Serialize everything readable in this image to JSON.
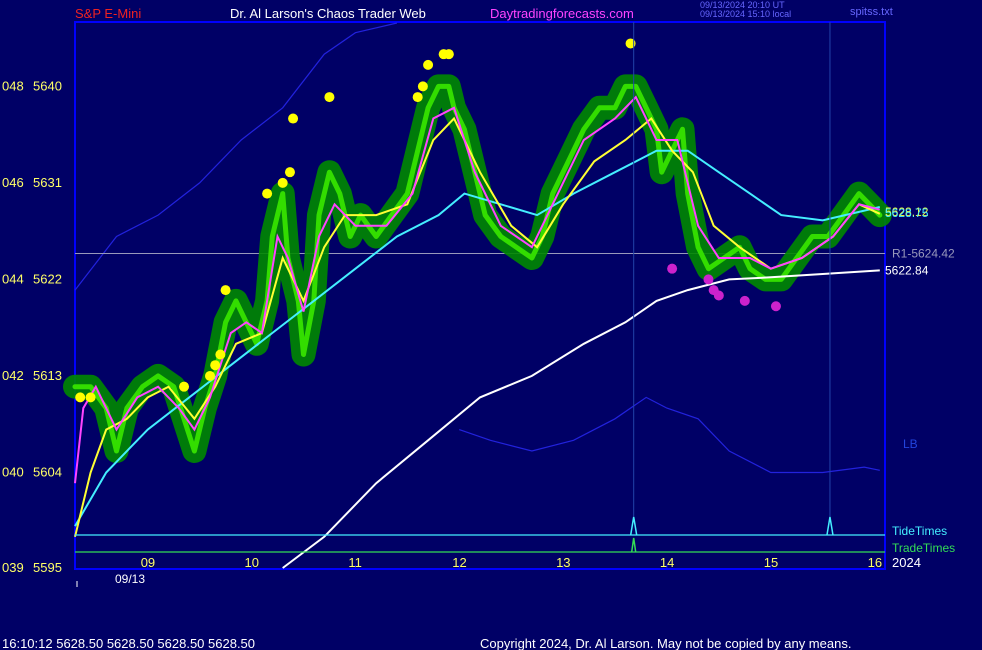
{
  "header": {
    "symbol": "S&P E-Mini",
    "site_title": "Dr. Al Larson's Chaos Trader Web",
    "url": "Daytradingforecasts.com",
    "timestamp_ut": "09/13/2024 20:10 UT",
    "timestamp_local": "09/13/2024 15:10 local",
    "file": "spitss.txt"
  },
  "footer": {
    "quote": "16:10:12  5628.50 5628.50 5628.50 5628.50",
    "copyright": "Copyright 2024, Dr. Al Larson. May not be copied by any means."
  },
  "colors": {
    "background": "#000066",
    "frame": "#0000ff",
    "price": "#33dd00",
    "price_glow": "#008800",
    "fast_avg": "#ff44ff",
    "mid_avg": "#ffff33",
    "slow_avg": "#44eeff",
    "long_avg": "#ffffff",
    "upper_band": "#2222dd",
    "tide": "#44eeff",
    "trade": "#33dd55",
    "yellow_dot": "#ffff00",
    "magenta_dot": "#cc22cc"
  },
  "chart_data": {
    "type": "line",
    "ylim": [
      5595,
      5646
    ],
    "y_ticks": [
      {
        "left": "039",
        "price": 5595,
        "label": "5595"
      },
      {
        "left": "040",
        "price": 5604,
        "label": "5604"
      },
      {
        "left": "042",
        "price": 5613,
        "label": "5613"
      },
      {
        "left": "044",
        "price": 5622,
        "label": "5622"
      },
      {
        "left": "046",
        "price": 5631,
        "label": "5631"
      },
      {
        "left": "048",
        "price": 5640,
        "label": "5640"
      }
    ],
    "x_ticks": [
      "09",
      "10",
      "11",
      "12",
      "13",
      "14",
      "15",
      "16"
    ],
    "x_tick_hours": [
      9,
      10,
      11,
      12,
      13,
      14,
      15,
      16
    ],
    "date_label": "09/13",
    "year_label": "2024",
    "xlim": [
      8.3,
      16.1
    ],
    "price_series": [
      [
        8.3,
        5612
      ],
      [
        8.45,
        5612
      ],
      [
        8.6,
        5610
      ],
      [
        8.7,
        5606
      ],
      [
        8.8,
        5610
      ],
      [
        8.95,
        5612
      ],
      [
        9.1,
        5613
      ],
      [
        9.25,
        5612
      ],
      [
        9.35,
        5609
      ],
      [
        9.45,
        5606
      ],
      [
        9.55,
        5610
      ],
      [
        9.65,
        5613
      ],
      [
        9.75,
        5618
      ],
      [
        9.85,
        5620
      ],
      [
        9.95,
        5618
      ],
      [
        10.05,
        5616
      ],
      [
        10.15,
        5620
      ],
      [
        10.2,
        5626
      ],
      [
        10.3,
        5630
      ],
      [
        10.35,
        5624
      ],
      [
        10.45,
        5620
      ],
      [
        10.5,
        5615
      ],
      [
        10.6,
        5620
      ],
      [
        10.65,
        5628
      ],
      [
        10.75,
        5632
      ],
      [
        10.85,
        5630
      ],
      [
        10.95,
        5626
      ],
      [
        11.05,
        5628
      ],
      [
        11.2,
        5626
      ],
      [
        11.35,
        5628
      ],
      [
        11.5,
        5630
      ],
      [
        11.6,
        5634
      ],
      [
        11.7,
        5638
      ],
      [
        11.8,
        5640
      ],
      [
        11.9,
        5640
      ],
      [
        11.95,
        5638
      ],
      [
        12.05,
        5636
      ],
      [
        12.15,
        5632
      ],
      [
        12.25,
        5628
      ],
      [
        12.4,
        5626
      ],
      [
        12.55,
        5625
      ],
      [
        12.7,
        5624
      ],
      [
        12.8,
        5626
      ],
      [
        12.9,
        5630
      ],
      [
        13.0,
        5632
      ],
      [
        13.1,
        5634
      ],
      [
        13.2,
        5636
      ],
      [
        13.35,
        5638
      ],
      [
        13.5,
        5638
      ],
      [
        13.6,
        5640
      ],
      [
        13.7,
        5640
      ],
      [
        13.8,
        5638
      ],
      [
        13.9,
        5636
      ],
      [
        13.95,
        5632
      ],
      [
        14.05,
        5634
      ],
      [
        14.15,
        5636
      ],
      [
        14.2,
        5630
      ],
      [
        14.3,
        5625
      ],
      [
        14.4,
        5623
      ],
      [
        14.55,
        5624
      ],
      [
        14.7,
        5625
      ],
      [
        14.8,
        5623
      ],
      [
        14.95,
        5622
      ],
      [
        15.1,
        5622
      ],
      [
        15.25,
        5624
      ],
      [
        15.4,
        5626
      ],
      [
        15.55,
        5626
      ],
      [
        15.7,
        5628
      ],
      [
        15.85,
        5630
      ],
      [
        15.95,
        5629
      ],
      [
        16.05,
        5628
      ]
    ],
    "fast_avg": [
      [
        8.3,
        5603
      ],
      [
        8.38,
        5610
      ],
      [
        8.5,
        5612
      ],
      [
        8.7,
        5608
      ],
      [
        8.9,
        5611
      ],
      [
        9.1,
        5612
      ],
      [
        9.3,
        5610
      ],
      [
        9.45,
        5608
      ],
      [
        9.6,
        5611
      ],
      [
        9.8,
        5617
      ],
      [
        9.95,
        5618
      ],
      [
        10.1,
        5617
      ],
      [
        10.25,
        5626
      ],
      [
        10.35,
        5624
      ],
      [
        10.5,
        5619
      ],
      [
        10.65,
        5626
      ],
      [
        10.8,
        5629
      ],
      [
        11.0,
        5627
      ],
      [
        11.3,
        5627
      ],
      [
        11.55,
        5630
      ],
      [
        11.75,
        5637
      ],
      [
        11.95,
        5638
      ],
      [
        12.15,
        5632
      ],
      [
        12.4,
        5627
      ],
      [
        12.7,
        5625
      ],
      [
        12.95,
        5630
      ],
      [
        13.2,
        5635
      ],
      [
        13.5,
        5637
      ],
      [
        13.7,
        5639
      ],
      [
        13.9,
        5635
      ],
      [
        14.1,
        5635
      ],
      [
        14.3,
        5627
      ],
      [
        14.5,
        5624
      ],
      [
        14.8,
        5624
      ],
      [
        15.0,
        5623
      ],
      [
        15.3,
        5624
      ],
      [
        15.6,
        5626
      ],
      [
        15.85,
        5629
      ],
      [
        16.05,
        5628.5
      ]
    ],
    "mid_avg": [
      [
        8.3,
        5598
      ],
      [
        8.45,
        5604
      ],
      [
        8.6,
        5608
      ],
      [
        8.8,
        5609
      ],
      [
        9.0,
        5611
      ],
      [
        9.2,
        5612
      ],
      [
        9.45,
        5609
      ],
      [
        9.65,
        5612
      ],
      [
        9.85,
        5616
      ],
      [
        10.1,
        5617
      ],
      [
        10.3,
        5624
      ],
      [
        10.5,
        5620
      ],
      [
        10.7,
        5625
      ],
      [
        10.9,
        5628
      ],
      [
        11.2,
        5628
      ],
      [
        11.5,
        5629
      ],
      [
        11.75,
        5635
      ],
      [
        11.95,
        5637
      ],
      [
        12.2,
        5632
      ],
      [
        12.5,
        5627
      ],
      [
        12.75,
        5625
      ],
      [
        13.0,
        5629
      ],
      [
        13.3,
        5633
      ],
      [
        13.6,
        5635
      ],
      [
        13.85,
        5637
      ],
      [
        14.05,
        5634
      ],
      [
        14.25,
        5632
      ],
      [
        14.45,
        5627
      ],
      [
        14.7,
        5625
      ],
      [
        15.0,
        5623
      ],
      [
        15.3,
        5624
      ],
      [
        15.6,
        5626
      ],
      [
        15.85,
        5629
      ],
      [
        16.05,
        5628.12
      ]
    ],
    "slow_avg": [
      [
        8.3,
        5599
      ],
      [
        8.6,
        5604
      ],
      [
        9.0,
        5608
      ],
      [
        9.4,
        5611
      ],
      [
        9.8,
        5614
      ],
      [
        10.2,
        5617
      ],
      [
        10.6,
        5620
      ],
      [
        11.0,
        5623
      ],
      [
        11.4,
        5626
      ],
      [
        11.8,
        5628
      ],
      [
        12.05,
        5630
      ],
      [
        12.4,
        5629
      ],
      [
        12.75,
        5628
      ],
      [
        13.1,
        5630
      ],
      [
        13.5,
        5632
      ],
      [
        13.9,
        5634
      ],
      [
        14.2,
        5634
      ],
      [
        14.5,
        5632
      ],
      [
        14.8,
        5630
      ],
      [
        15.1,
        5628
      ],
      [
        15.5,
        5627.5
      ],
      [
        16.05,
        5628.75
      ]
    ],
    "long_avg": [
      [
        10.3,
        5595
      ],
      [
        10.7,
        5598
      ],
      [
        11.2,
        5603
      ],
      [
        11.7,
        5607
      ],
      [
        12.2,
        5611
      ],
      [
        12.7,
        5613
      ],
      [
        13.2,
        5616
      ],
      [
        13.6,
        5618
      ],
      [
        13.9,
        5620
      ],
      [
        14.2,
        5621
      ],
      [
        14.6,
        5622
      ],
      [
        15.0,
        5622.2
      ],
      [
        15.5,
        5622.5
      ],
      [
        16.05,
        5622.84
      ]
    ],
    "upper_band": [
      [
        8.3,
        5621
      ],
      [
        8.7,
        5626
      ],
      [
        9.1,
        5628
      ],
      [
        9.5,
        5631
      ],
      [
        9.9,
        5635
      ],
      [
        10.3,
        5638
      ],
      [
        10.7,
        5643
      ],
      [
        11.0,
        5645
      ],
      [
        11.4,
        5647
      ]
    ],
    "lower_band": [
      [
        12.0,
        5608
      ],
      [
        12.3,
        5607
      ],
      [
        12.7,
        5606
      ],
      [
        13.1,
        5607
      ],
      [
        13.5,
        5609
      ],
      [
        13.8,
        5611
      ],
      [
        14.0,
        5610
      ],
      [
        14.3,
        5609
      ],
      [
        14.6,
        5606
      ],
      [
        15.0,
        5604
      ],
      [
        15.5,
        5604
      ],
      [
        15.9,
        5604.5
      ],
      [
        16.05,
        5604.2
      ]
    ],
    "r1_level": 5624.42,
    "r1_label": "R1-5624.42",
    "right_labels": [
      {
        "price": 5628.12,
        "text": "5628.12",
        "color": "#ffff33"
      },
      {
        "price": 5628.75,
        "text": "5628.75",
        "color": "#44eeff"
      },
      {
        "price": 5622.84,
        "text": "5622.84",
        "color": "#ffffff"
      }
    ],
    "lb_label": "LB",
    "tide_label": "TideTimes",
    "trade_label": "TradeTimes",
    "tide_spikes": [
      13.68,
      15.57
    ],
    "trade_spikes": [
      13.68
    ],
    "yellow_dots": [
      [
        8.35,
        5611
      ],
      [
        8.45,
        5611
      ],
      [
        9.35,
        5612
      ],
      [
        9.75,
        5621
      ],
      [
        9.6,
        5613
      ],
      [
        9.65,
        5614
      ],
      [
        9.7,
        5615
      ],
      [
        10.15,
        5630
      ],
      [
        10.3,
        5631
      ],
      [
        10.37,
        5632
      ],
      [
        10.4,
        5637
      ],
      [
        10.75,
        5639
      ],
      [
        11.6,
        5639
      ],
      [
        11.65,
        5640
      ],
      [
        11.7,
        5642
      ],
      [
        11.85,
        5643
      ],
      [
        11.9,
        5643
      ],
      [
        13.65,
        5644
      ]
    ],
    "magenta_dots": [
      [
        14.05,
        5623
      ],
      [
        14.4,
        5622
      ],
      [
        14.45,
        5621
      ],
      [
        14.5,
        5620.5
      ],
      [
        14.75,
        5620
      ],
      [
        15.05,
        5619.5
      ]
    ]
  }
}
